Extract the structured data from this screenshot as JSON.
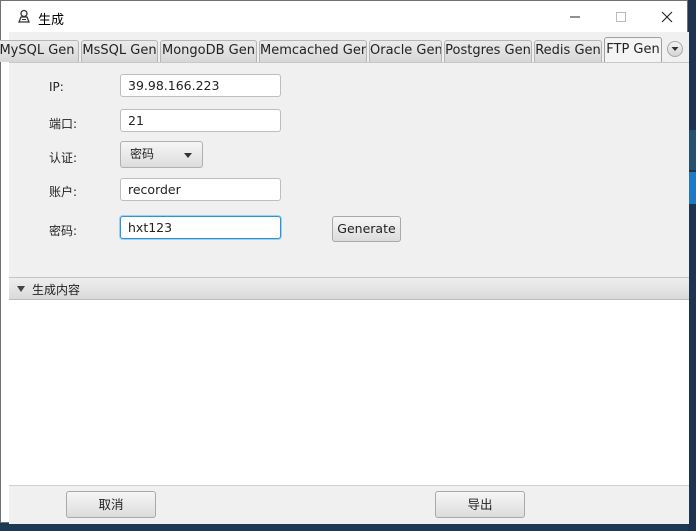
{
  "window": {
    "title": "生成"
  },
  "tabs": [
    {
      "label": "MySQL Gen",
      "active": false
    },
    {
      "label": "MsSQL Gen",
      "active": false
    },
    {
      "label": "MongoDB Gen",
      "active": false
    },
    {
      "label": "Memcached Gen",
      "active": false
    },
    {
      "label": "Oracle Gen",
      "active": false
    },
    {
      "label": "Postgres Gen",
      "active": false
    },
    {
      "label": "Redis Gen",
      "active": false
    },
    {
      "label": "FTP Gen",
      "active": true
    }
  ],
  "form": {
    "ip": {
      "label": "IP:",
      "value": "39.98.166.223"
    },
    "port": {
      "label": "端口:",
      "value": "21"
    },
    "auth": {
      "label": "认证:",
      "value": "密码"
    },
    "account": {
      "label": "账户:",
      "value": "recorder"
    },
    "password": {
      "label": "密码:",
      "value": "hxt123"
    },
    "generate_label": "Generate"
  },
  "output_pane": {
    "title": "生成内容",
    "content": ""
  },
  "footer": {
    "cancel_label": "取消",
    "export_label": "导出"
  }
}
